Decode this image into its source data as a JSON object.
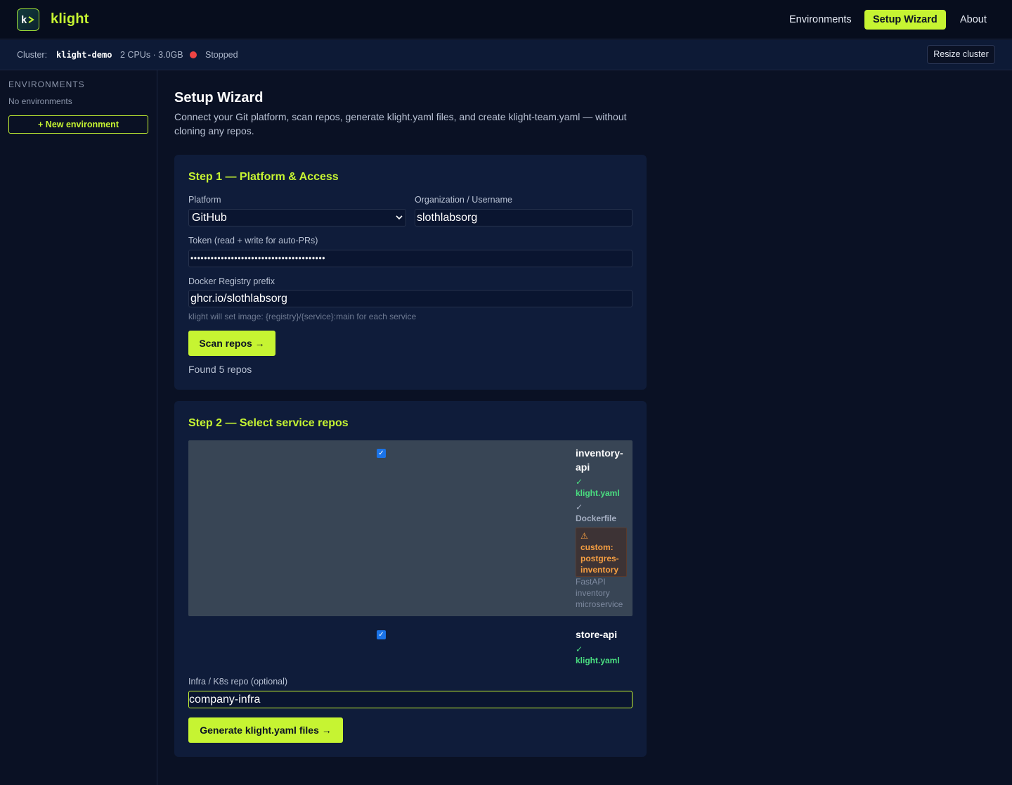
{
  "app": {
    "name": "klight",
    "logo_glyph": "k>"
  },
  "nav": {
    "environments": "Environments",
    "setup_wizard": "Setup Wizard",
    "about": "About"
  },
  "cluster": {
    "label": "Cluster:",
    "name": "klight-demo",
    "resources": "2 CPUs · 3.0GB",
    "status": "Stopped",
    "status_color": "#ef4444",
    "resize_label": "Resize cluster"
  },
  "sidebar": {
    "heading": "ENVIRONMENTS",
    "empty_text": "No environments",
    "new_button": "+ New environment"
  },
  "page": {
    "title": "Setup Wizard",
    "description": "Connect your Git platform, scan repos, generate klight.yaml files, and create klight-team.yaml — without cloning any repos."
  },
  "step1": {
    "title": "Step 1 — Platform & Access",
    "platform_label": "Platform",
    "platform_value": "GitHub",
    "org_label": "Organization / Username",
    "org_value": "slothlabsorg",
    "token_label": "Token (read + write for auto-PRs)",
    "token_value": "••••••••••••••••••••••••••••••••••••••••",
    "registry_label": "Docker Registry prefix",
    "registry_value": "ghcr.io/slothlabsorg",
    "registry_hint": "klight will set image: {registry}/{service}:main for each service",
    "scan_button": "Scan repos →",
    "found_text": "Found 5 repos"
  },
  "step2": {
    "title": "Step 2 — Select service repos",
    "repos": [
      {
        "name_line1": "inventory-",
        "name_line2": "api",
        "checked": true,
        "klight_check": "✓",
        "klight_label": "klight.yaml",
        "docker_check": "✓",
        "docker_label": "Dockerfile",
        "warn_icon": "⚠",
        "warn_lines": [
          "custom:",
          "postgres-",
          "inventory"
        ],
        "desc_lines": [
          "FastAPI",
          "inventory",
          "microservice"
        ]
      },
      {
        "name": "store-api",
        "checked": true,
        "klight_check": "✓",
        "klight_label": "klight.yaml"
      }
    ],
    "infra_label": "Infra / K8s repo (optional)",
    "infra_value": "company-infra",
    "generate_button": "Generate klight.yaml files →"
  },
  "colors": {
    "accent": "#c6f432",
    "success": "#4ade80",
    "warning": "#f59e42",
    "bg": "#0a1124",
    "card": "#0f1c3a"
  }
}
